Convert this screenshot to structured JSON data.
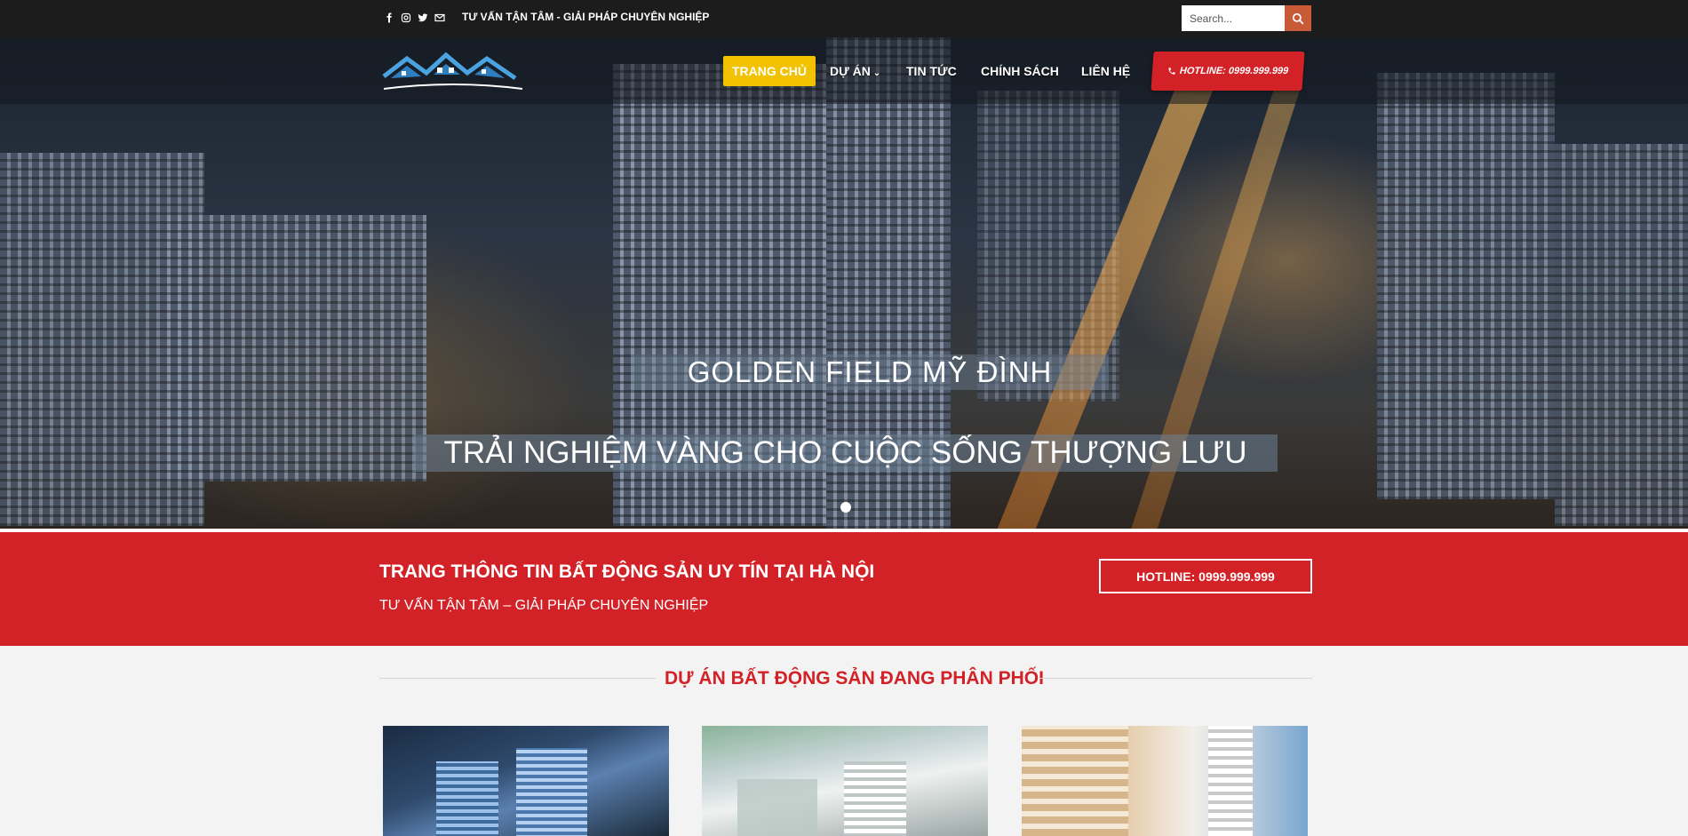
{
  "topbar": {
    "social_icons": [
      "facebook-icon",
      "instagram-icon",
      "twitter-icon",
      "mail-icon"
    ],
    "tagline": "TƯ VẤN TẬN TÂM - GIẢI PHÁP CHUYÊN NGHIỆP",
    "search_placeholder": "Search..."
  },
  "nav": {
    "items": [
      {
        "label": "TRANG CHỦ",
        "active": true
      },
      {
        "label": "DỰ ÁN",
        "has_dropdown": true
      },
      {
        "label": "TIN TỨC"
      },
      {
        "label": "CHÍNH SÁCH"
      },
      {
        "label": "LIÊN HỆ"
      }
    ],
    "hotline": "HOTLINE: 0999.999.999"
  },
  "hero": {
    "title": "GOLDEN FIELD MỸ ĐÌNH",
    "subtitle": "TRẢI NGHIỆM VÀNG CHO CUỘC SỐNG THƯỢNG LƯU"
  },
  "band": {
    "title": "TRANG THÔNG TIN BẤT ĐỘNG SẢN UY TÍN TẠI HÀ NỘI",
    "subtitle": "TƯ VẤN TẬN TÂM – GIẢI PHÁP CHUYÊN NGHIỆP",
    "hotline": "HOTLINE: 0999.999.999"
  },
  "section": {
    "title": "DỰ ÁN BẤT ĐỘNG SẢN ĐANG PHÂN PHỐI"
  },
  "colors": {
    "accent_red": "#d32227",
    "active_nav": "#f2c100",
    "topbar": "#1c1c1c",
    "search_button": "#c95a38"
  }
}
